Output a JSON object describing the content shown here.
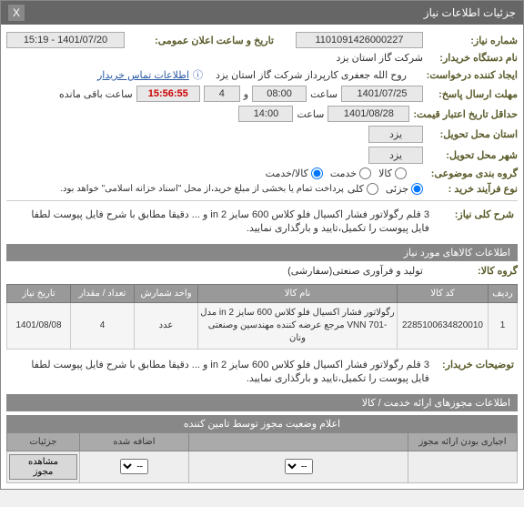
{
  "header": {
    "title": "جزئیات اطلاعات نیاز",
    "close": "X"
  },
  "fields": {
    "need_no_label": "شماره نیاز:",
    "need_no": "1101091426000227",
    "announce_date_label": "تاریخ و ساعت اعلان عمومی:",
    "announce_date": "1401/07/20 - 15:19",
    "buyer_org_label": "نام دستگاه خریدار:",
    "buyer_org": "شرکت گاز استان یزد",
    "requester_label": "ایجاد کننده درخواست:",
    "requester": "روح الله جعفری کارپرداز شرکت گاز استان یزد",
    "contact_link": "اطلاعات تماس خریدار",
    "reply_deadline_label": "مهلت ارسال پاسخ:",
    "reply_date": "1401/07/25",
    "time_label1": "ساعت",
    "reply_time": "08:00",
    "and": "و",
    "remain_count": "4",
    "remain_clock": "15:56:55",
    "remain_suffix": "ساعت باقی مانده",
    "min_valid_label": "حداقل تاریخ اعتبار قیمت:",
    "min_valid_date": "1401/08/28",
    "time_label2": "ساعت",
    "min_valid_time": "14:00",
    "job_province_label": "استان محل تحویل:",
    "job_province": "یزد",
    "job_city_label": "شهر محل تحویل:",
    "job_city": "یزد",
    "subject_group_label": "گروه بندی موضوعی:",
    "go_kala": "کالا",
    "go_service": "کالا/خدمت",
    "go_service2": "خدمت",
    "purchase_type_label": "نوع فرآیند خرید :",
    "pt_partial": "جزئی",
    "pt_full": "کلی",
    "purchase_note": "پرداخت تمام یا بخشی از مبلغ خرید،از محل \"اسناد خزانه اسلامی\" خواهد بود."
  },
  "need_summary": {
    "label": "شرح کلی نیاز:",
    "text": "3 قلم رگولاتور فشار اکسیال فلو کلاس 600 سایز 2 in و ... دقیقا مطابق با شرح فایل پیوست لطفا فایل پیوست را تکمیل،تایید و بارگذاری نمایید."
  },
  "section_titles": {
    "items": "اطلاعات کالاهای مورد نیاز",
    "approvals": "اطلاعات مجوزهای ارائه خدمت / کالا",
    "approval_sub": "اعلام وضعیت مجوز توسط تامین کننده"
  },
  "goods_group": {
    "label": "گروه کالا:",
    "value": "تولید و فرآوری صنعتی(سفارشی)"
  },
  "items_table": {
    "headers": {
      "row": "ردیف",
      "code": "کد کالا",
      "name": "نام کالا",
      "unit": "واحد شمارش",
      "qty": "تعداد / مقدار",
      "date": "تاریخ نیاز"
    },
    "rows": [
      {
        "row": "1",
        "code": "2285100634820010",
        "name": "رگولاتور فشار اکسیال فلو کلاس 600 سایز 2 in مدل -VNN 701 مرجع عرضه کننده مهندسین وصنعتی ونان",
        "unit": "عدد",
        "qty": "4",
        "date": "1401/08/08"
      }
    ]
  },
  "buyer_notes": {
    "label": "توضیحات خریدار:",
    "text": "3 قلم رگولاتور فشار اکسیال فلو کلاس 600 سایز 2 in و ... دقیقا مطابق با شرح فایل پیوست لطفا فایل پیوست را تکمیل،تایید و بارگذاری نمایید."
  },
  "approval_table": {
    "headers": {
      "mandatory": "اجباری بودن ارائه مجوز",
      "select": "",
      "added": "اضافه شده",
      "details": "جزئیات"
    },
    "select_option": "--",
    "details_btn": "مشاهده مجوز"
  }
}
